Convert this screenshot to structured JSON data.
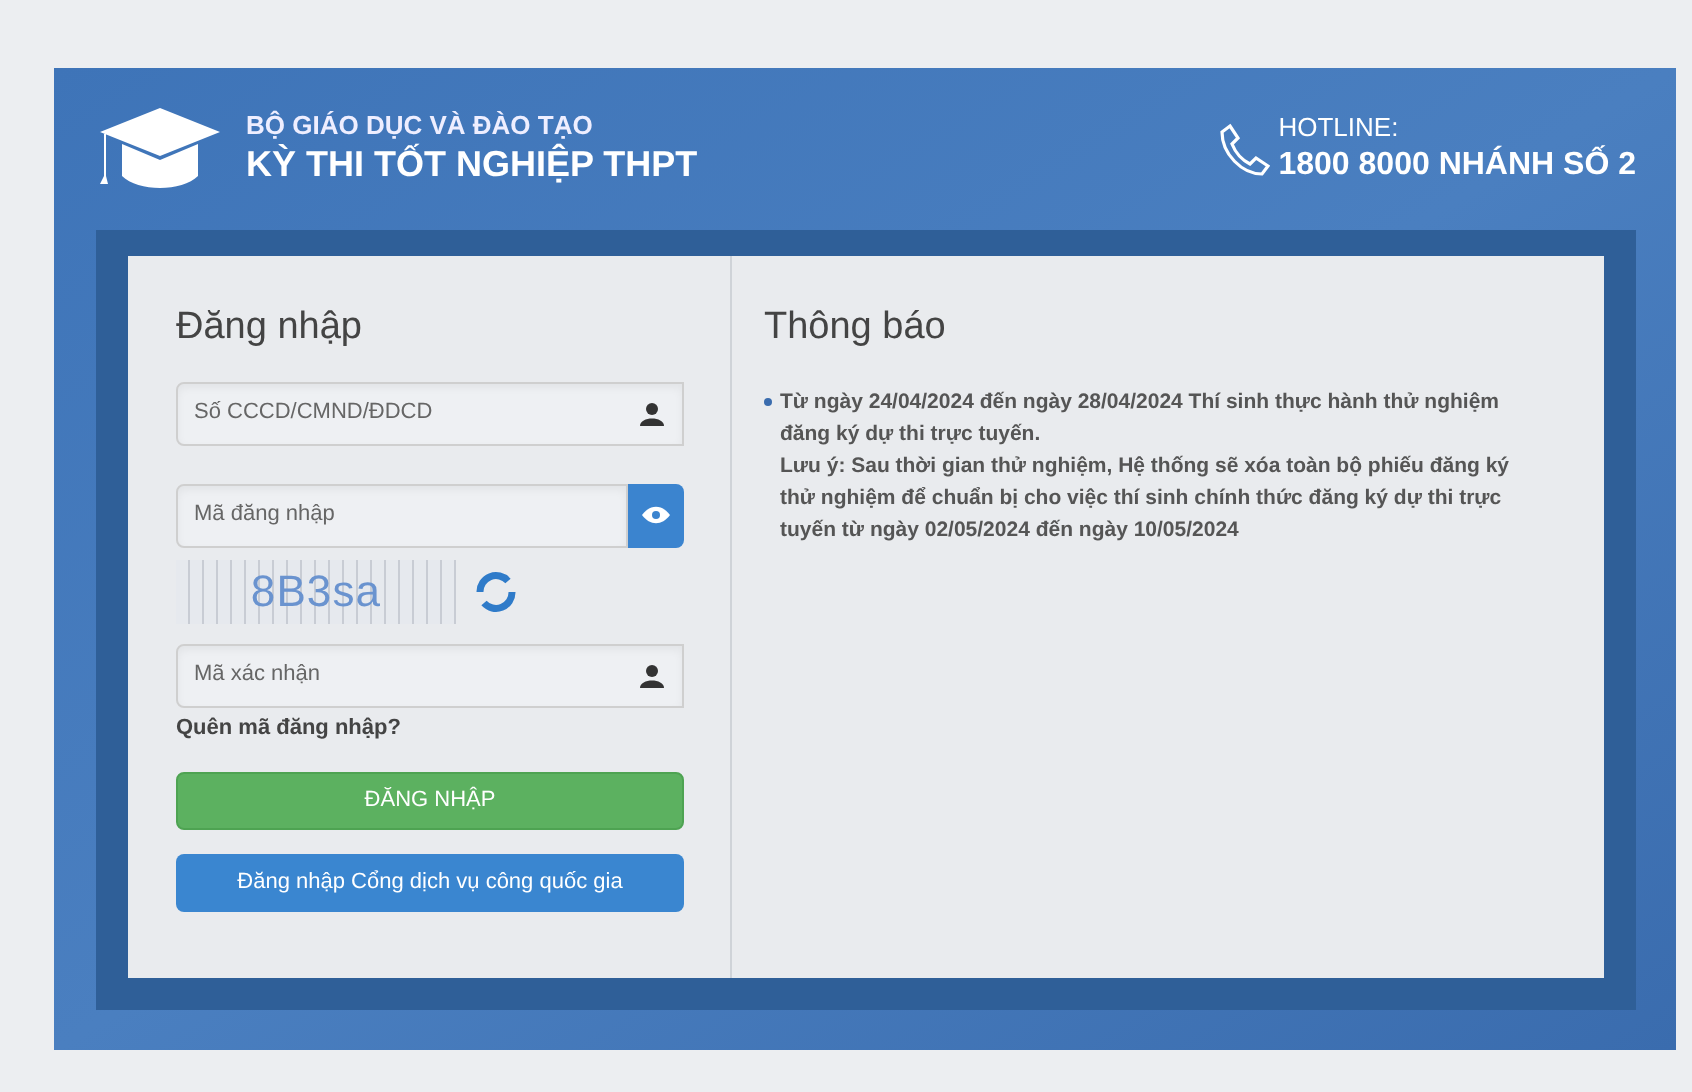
{
  "header": {
    "ministry": "BỘ GIÁO DỤC VÀ ĐÀO TẠO",
    "exam": "KỲ THI TỐT NGHIỆP THPT",
    "hotline_label": "HOTLINE:",
    "hotline_number": "1800 8000 NHÁNH SỐ 2"
  },
  "login": {
    "title": "Đăng nhập",
    "id_field": {
      "placeholder": "Số CCCD/CMND/ĐDCD"
    },
    "code_field": {
      "placeholder": "Mã đăng nhập"
    },
    "captcha": {
      "text": "8B3sa"
    },
    "captcha_field": {
      "placeholder": "Mã xác nhận"
    },
    "forgot_link": "Quên mã đăng nhập?",
    "submit_button": "ĐĂNG NHẬP",
    "portal_button": "Đăng nhập Cổng dịch vụ công quốc gia"
  },
  "notices": {
    "title": "Thông báo",
    "items": [
      {
        "lines": [
          "Từ ngày 24/04/2024 đến ngày 28/04/2024 Thí sinh thực hành thử nghiệm đăng ký dự thi trực tuyến.",
          "Lưu ý: Sau thời gian thử nghiệm, Hệ thống sẽ xóa toàn bộ phiếu đăng ký thử nghiệm để chuẩn bị cho việc thí sinh chính thức đăng ký dự thi trực tuyến từ ngày 02/05/2024 đến ngày 10/05/2024"
        ]
      }
    ]
  }
}
